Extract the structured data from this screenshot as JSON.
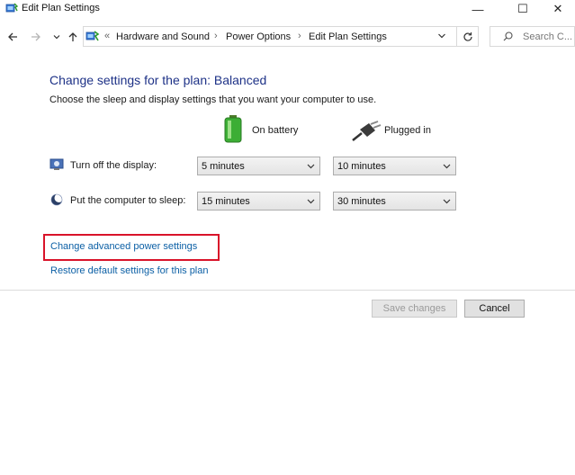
{
  "window": {
    "title": "Edit Plan Settings",
    "controls": {
      "minimize": "—",
      "maximize": "☐",
      "close": "✕"
    }
  },
  "address_bar": {
    "overflow": "«",
    "breadcrumbs": [
      "Hardware and Sound",
      "Power Options",
      "Edit Plan Settings"
    ],
    "separator": "›",
    "search_placeholder": "Search C..."
  },
  "main": {
    "heading": "Change settings for the plan: Balanced",
    "subtitle": "Choose the sleep and display settings that you want your computer to use.",
    "columns": {
      "battery": "On battery",
      "plugged": "Plugged in"
    },
    "rows": [
      {
        "label": "Turn off the display:",
        "battery": "5 minutes",
        "plugged": "10 minutes"
      },
      {
        "label": "Put the computer to sleep:",
        "battery": "15 minutes",
        "plugged": "30 minutes"
      }
    ],
    "links": {
      "advanced": "Change advanced power settings",
      "restore": "Restore default settings for this plan"
    }
  },
  "buttons": {
    "save": "Save changes",
    "cancel": "Cancel"
  },
  "colors": {
    "heading": "#1e3287",
    "link": "#0b5fa5",
    "highlight": "#d9132a"
  }
}
